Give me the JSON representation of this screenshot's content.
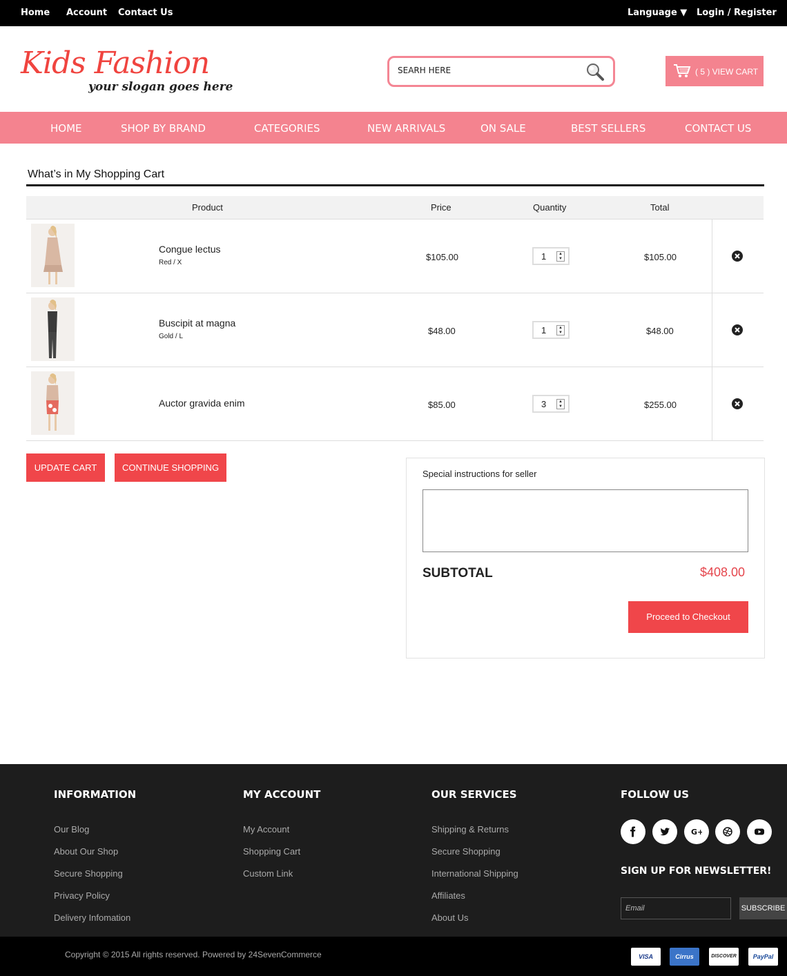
{
  "topbar": {
    "home": "Home",
    "account": "Account",
    "contact": "Contact Us",
    "language": "Language ▼",
    "login": "Login / Register"
  },
  "header": {
    "logo_title": "Kids Fashion",
    "logo_slogan": "your slogan goes here",
    "search_placeholder": "SEARH HERE",
    "cart_label": "( 5 ) VIEW CART"
  },
  "nav": [
    "HOME",
    "SHOP BY BRAND",
    "CATEGORIES",
    "NEW ARRIVALS",
    "ON SALE",
    "BEST SELLERS",
    "CONTACT US"
  ],
  "cart": {
    "title": "What’s in My Shopping Cart",
    "columns": {
      "product": "Product",
      "price": "Price",
      "quantity": "Quantity",
      "total": "Total"
    },
    "items": [
      {
        "name": "Congue lectus",
        "variant": "Red / X",
        "price": "$105.00",
        "qty": "1",
        "total": "$105.00"
      },
      {
        "name": "Buscipit at magna",
        "variant": "Gold / L",
        "price": "$48.00",
        "qty": "1",
        "total": "$48.00"
      },
      {
        "name": "Auctor gravida enim",
        "variant": "",
        "price": "$85.00",
        "qty": "3",
        "total": "$255.00"
      }
    ],
    "update_label": "UPDATE CART",
    "continue_label": "CONTINUE SHOPPING"
  },
  "summary": {
    "instructions_label": "Special instructions for seller",
    "subtotal_label": "SUBTOTAL",
    "subtotal_value": "$408.00",
    "checkout_label": "Proceed to Checkout"
  },
  "footer": {
    "information": {
      "heading": "INFORMATION",
      "links": [
        "Our Blog",
        "About Our Shop",
        "Secure Shopping",
        "Privacy Policy",
        "Delivery Infomation"
      ]
    },
    "my_account": {
      "heading": "MY ACCOUNT",
      "links": [
        "My Account",
        "Shopping Cart",
        "Custom Link"
      ]
    },
    "services": {
      "heading": "OUR SERVICES",
      "links": [
        "Shipping & Returns",
        "Secure Shopping",
        "International Shipping",
        "Affiliates",
        "About Us"
      ]
    },
    "follow": {
      "heading": "FOLLOW US",
      "icons": [
        "facebook-icon",
        "twitter-icon",
        "google-plus-icon",
        "dribbble-icon",
        "youtube-icon"
      ]
    },
    "newsletter_title": "SIGN UP FOR NEWSLETTER!",
    "email_placeholder": "Email",
    "subscribe_label": "SUBSCRIBE",
    "copyright": "Copyright © 2015 All rights reserved. Powered by 24SevenCommerce",
    "payments": [
      "VISA",
      "Cirrus",
      "DISCOVER",
      "PayPal"
    ]
  },
  "colors": {
    "accent": "#f4838f",
    "button": "#f0464a",
    "price_red": "#e5464d",
    "footer_bg": "#1d1d1d"
  }
}
